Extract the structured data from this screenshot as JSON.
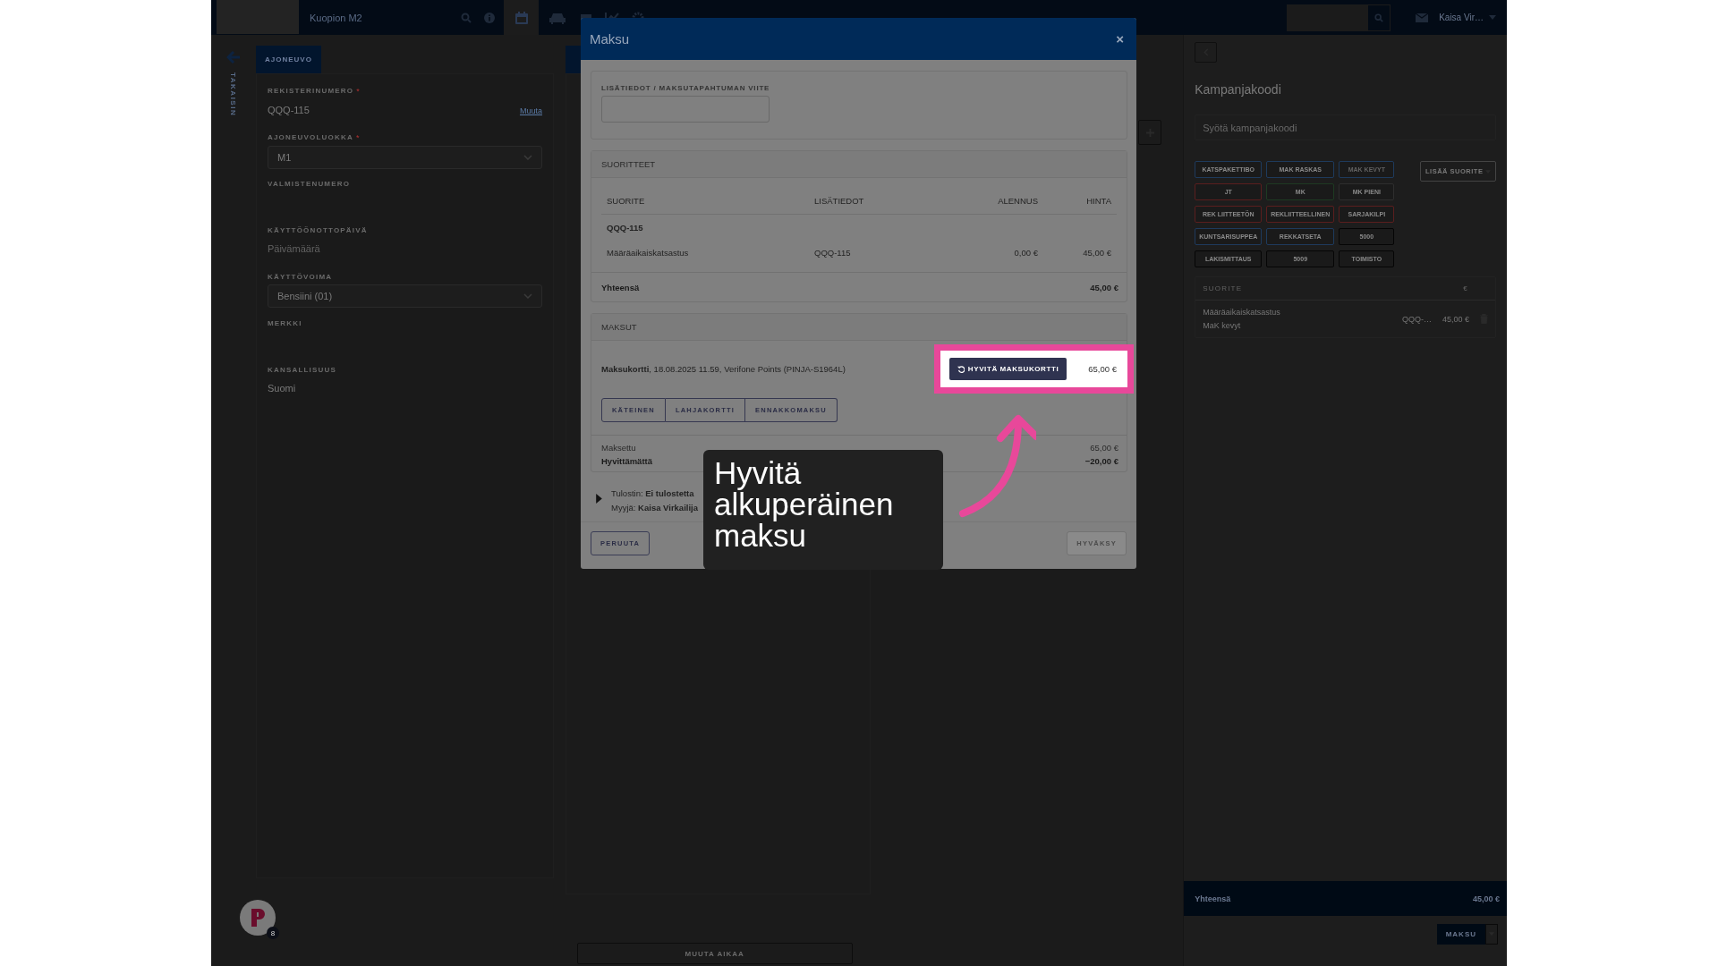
{
  "top_bar": {
    "location": "Kuopion M2",
    "user": "Kaisa Vir…"
  },
  "back": {
    "label": "TAKAISIN"
  },
  "vehicle": {
    "tab": "AJONEUVO",
    "fields": [
      {
        "label": "REKISTERINUMERO",
        "required_mark": "*",
        "kind": "text",
        "value": "QQQ-115",
        "link": "Muuta"
      },
      {
        "label": "AJONEUVOLUOKKA",
        "required_mark": "*",
        "kind": "select",
        "value": "M1"
      },
      {
        "label": "VALMISTENUMERO",
        "kind": "text"
      },
      {
        "label": "KÄYTTÖÖNOTTOPÄIVÄ",
        "kind": "text",
        "placeholder": "Päivämäärä"
      },
      {
        "label": "KÄYTTÖVOIMA",
        "kind": "select",
        "value": "Bensiini (01)"
      },
      {
        "label": "MERKKI",
        "kind": "text"
      },
      {
        "label": "KANSALLISUUS",
        "kind": "text",
        "value": "Suomi"
      }
    ]
  },
  "schedule": {
    "change_time_button": "MUUTA AIKAA"
  },
  "notifications": {
    "count": "8"
  },
  "campaign": {
    "title": "Kampanjakoodi",
    "placeholder": "Syötä kampanjakoodi",
    "add_button": "LISÄÄ SUORITE",
    "chips": [
      {
        "label": "KATSPAKETTIBO",
        "color": "#1e3a5c",
        "disabled": false
      },
      {
        "label": "MAK RASKAS",
        "color": "#1e3a5c",
        "disabled": false
      },
      {
        "label": "MAK KEVYT",
        "color": "#1e3a5c",
        "disabled": true
      },
      {
        "label": "JT",
        "color": "#5a1e1e",
        "disabled": false
      },
      {
        "label": "MK",
        "color": "#1e3a22",
        "disabled": false
      },
      {
        "label": "MK PIENI",
        "color": "#2e2e2e",
        "disabled": false
      },
      {
        "label": "REK LIITTEETÖN",
        "color": "#5a1e1e",
        "disabled": false
      },
      {
        "label": "REKLIITTEELLINEN",
        "color": "#5a1e1e",
        "disabled": false
      },
      {
        "label": "SARJAKILPI",
        "color": "#5a1e1e",
        "disabled": false
      },
      {
        "label": "KUNTSARISUPPEA",
        "color": "#1e3a5c",
        "disabled": false
      },
      {
        "label": "REKKATSETA",
        "color": "#1e3a5c",
        "disabled": false
      },
      {
        "label": "5000",
        "color": "#050505",
        "disabled": false
      },
      {
        "label": "LAKISMITTAUS",
        "color": "#050505",
        "disabled": false
      },
      {
        "label": "5009",
        "color": "#050505",
        "disabled": false
      },
      {
        "label": "TOIMISTO",
        "color": "#050505",
        "disabled": false
      }
    ],
    "table": {
      "columns": [
        "SUORITE",
        "€"
      ],
      "rows": [
        {
          "name": "Määräaikaiskatsastus",
          "detail": "MaK kevyt",
          "vehicle": "QQQ-…",
          "price": "45,00 €"
        }
      ]
    },
    "total": {
      "label": "Yhteensä",
      "value": "45,00 €"
    },
    "pay_button": "MAKSU"
  },
  "modal": {
    "title": "Maksu",
    "close": "×",
    "reference": {
      "label": "LISÄTIEDOT / MAKSUTAPAHTUMAN VIITE"
    },
    "services": {
      "title": "SUORITTEET",
      "columns": [
        "SUORITE",
        "LISÄTIEDOT",
        "ALENNUS",
        "HINTA"
      ],
      "groups": [
        {
          "title": "QQQ-115",
          "rows": [
            {
              "cells": [
                "Määräaikaiskatsastus",
                "QQQ-115",
                "0,00 €",
                "45,00 €"
              ]
            }
          ]
        }
      ],
      "total": {
        "label": "Yhteensä",
        "value": "45,00 €"
      }
    },
    "payments": {
      "title": "MAKSUT",
      "items": [
        {
          "text": "**Maksukortti**, 18.08.2025 11.59, Verifone Points (PINJA-S1964L)",
          "refund_button": "HYVITÄ MAKSUKORTTI",
          "amount": "65,00 €",
          "highlighted": true
        }
      ],
      "methods": [
        "KÄTEINEN",
        "LAHJAKORTTI",
        "ENNAKKOMAKSU"
      ],
      "paid": {
        "label": "Maksettu",
        "value": "65,00 €"
      },
      "unrefunded": {
        "label": "Hyvittämättä",
        "value": "−20,00 €"
      }
    },
    "printer": "Tulostin: **Ei tulostetta**",
    "seller": "Myyjä: **Kaisa Virkailija**",
    "cancel_button": "PERUUTA",
    "accept_button": {
      "label": "HYVÄKSY",
      "disabled": true
    }
  },
  "callout": {
    "text": "Hyvitä alkuperäinen maksu"
  }
}
